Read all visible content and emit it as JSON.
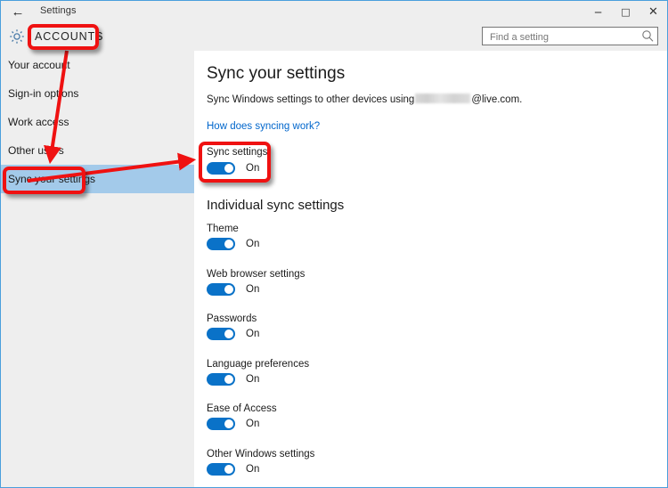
{
  "window": {
    "titlebar_title": "Settings",
    "back_icon": "back-arrow-icon",
    "minimize_label": "─",
    "maximize_label": "□",
    "close_label": "✕",
    "border_color": "#4a9fdc"
  },
  "header": {
    "gear_icon": "gear-icon",
    "category_title": "ACCOUNTS"
  },
  "search": {
    "placeholder": "Find a setting",
    "value": "",
    "icon": "search-icon"
  },
  "sidebar": {
    "items": [
      {
        "label": "Your account",
        "selected": false
      },
      {
        "label": "Sign-in options",
        "selected": false
      },
      {
        "label": "Work access",
        "selected": false
      },
      {
        "label": "Other users",
        "selected": false
      },
      {
        "label": "Sync your settings",
        "selected": true
      }
    ],
    "selected_bg": "#a3caea",
    "bg": "#eeeeee"
  },
  "main": {
    "page_title": "Sync your settings",
    "description_prefix": "Sync Windows settings to other devices using",
    "description_suffix": "@live.com.",
    "help_link": "How does syncing work?",
    "help_link_color": "#0066cc",
    "master_toggle": {
      "label": "Sync settings",
      "state": "On",
      "on": true
    },
    "individual_heading": "Individual sync settings",
    "individual_settings": [
      {
        "label": "Theme",
        "state": "On",
        "on": true
      },
      {
        "label": "Web browser settings",
        "state": "On",
        "on": true
      },
      {
        "label": "Passwords",
        "state": "On",
        "on": true
      },
      {
        "label": "Language preferences",
        "state": "On",
        "on": true
      },
      {
        "label": "Ease of Access",
        "state": "On",
        "on": true
      },
      {
        "label": "Other Windows settings",
        "state": "On",
        "on": true
      }
    ],
    "toggle_on_color": "#0a72c8"
  },
  "annotations": {
    "color": "#ef1111",
    "boxes": [
      {
        "name": "accounts-highlight",
        "target": "ACCOUNTS"
      },
      {
        "name": "sidebar-sync-highlight",
        "target": "Sync your settings"
      },
      {
        "name": "sync-settings-toggle-highlight",
        "target": "Sync settings"
      }
    ],
    "arrows": [
      {
        "name": "arrow-accounts-to-sidebar",
        "from": "ACCOUNTS",
        "to": "Sync your settings"
      },
      {
        "name": "arrow-sidebar-to-toggle",
        "from": "Sync your settings",
        "to": "Sync settings"
      }
    ]
  }
}
